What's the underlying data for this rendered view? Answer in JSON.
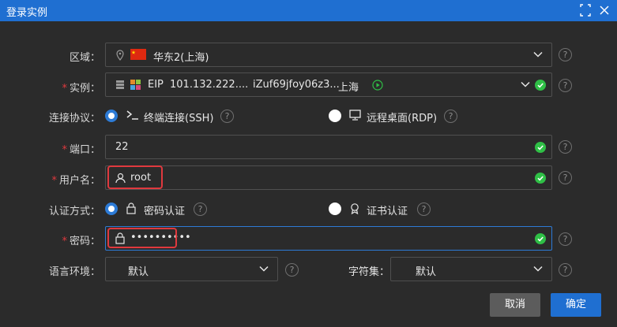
{
  "dialog": {
    "title": "登录实例"
  },
  "region": {
    "label": "区域：",
    "value": "华东2(上海)",
    "flag": "china-flag-icon"
  },
  "instance": {
    "label": "实例：",
    "eip_prefix": "EIP",
    "ip": "101.132.222....",
    "id": "iZuf69jfoy06z3...",
    "region": "上海"
  },
  "protocol": {
    "label": "连接协议：",
    "options": [
      {
        "label": "终端连接(SSH)",
        "selected": true
      },
      {
        "label": "远程桌面(RDP)",
        "selected": false
      }
    ]
  },
  "port": {
    "label": "端口：",
    "value": "22"
  },
  "username": {
    "label": "用户名：",
    "value": "root"
  },
  "auth": {
    "label": "认证方式：",
    "options": [
      {
        "label": "密码认证",
        "selected": true
      },
      {
        "label": "证书认证",
        "selected": false
      }
    ]
  },
  "password": {
    "label": "密码：",
    "value": "••••••••••"
  },
  "locale": {
    "label": "语言环境：",
    "value": "默认"
  },
  "charset": {
    "label": "字符集：",
    "value": "默认"
  },
  "buttons": {
    "cancel": "取消",
    "ok": "确定"
  },
  "colors": {
    "accent": "#1f6fd1",
    "success": "#2fbf46",
    "required": "#e0393e",
    "highlight_box": "#e0393e"
  }
}
